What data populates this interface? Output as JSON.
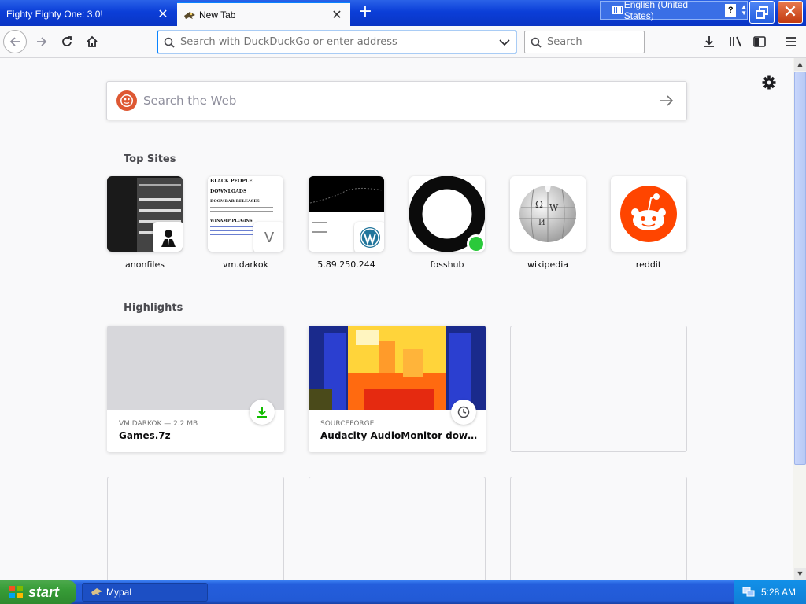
{
  "tabs": [
    {
      "title": "Eighty Eighty One: 3.0!"
    },
    {
      "title": "New Tab"
    }
  ],
  "language_bar": {
    "language": "English (United States)",
    "help": "?"
  },
  "navbar": {
    "url_placeholder": "Search with DuckDuckGo or enter address",
    "search_placeholder": "Search"
  },
  "newtab": {
    "web_search_placeholder": "Search the Web",
    "top_sites_title": "Top Sites",
    "top_sites": [
      {
        "label": "anonfiles"
      },
      {
        "label": "vm.darkok",
        "badge_letter": "V"
      },
      {
        "label": "5.89.250.244"
      },
      {
        "label": "fosshub"
      },
      {
        "label": "wikipedia"
      },
      {
        "label": "reddit"
      }
    ],
    "vm_darkok_preview": {
      "heading1": "BLACK PEOPLE",
      "heading2": "DOWNLOADS",
      "heading3": "BOOMBAR RELEASES",
      "heading4": "WINAMP PLUGINS"
    },
    "highlights_title": "Highlights",
    "highlights": [
      {
        "meta": "VM.DARKOK — 2.2 MB",
        "title": "Games.7z",
        "badge_icon": "download-icon"
      },
      {
        "meta": "SOURCEFORGE",
        "title": "Audacity AudioMonitor downloa...",
        "badge_icon": "clock-icon"
      }
    ]
  },
  "taskbar": {
    "start_label": "start",
    "window_label": "Mypal",
    "clock": "5:28 AM"
  },
  "colors": {
    "titlebar_blue": "#0b3ed8",
    "focus_blue": "#0a84ff",
    "download_green": "#12bc00",
    "reddit_orange": "#ff4500",
    "fosshub_dot": "#2ac93a",
    "ddg_orange": "#de5833",
    "start_green": "#379c37"
  }
}
